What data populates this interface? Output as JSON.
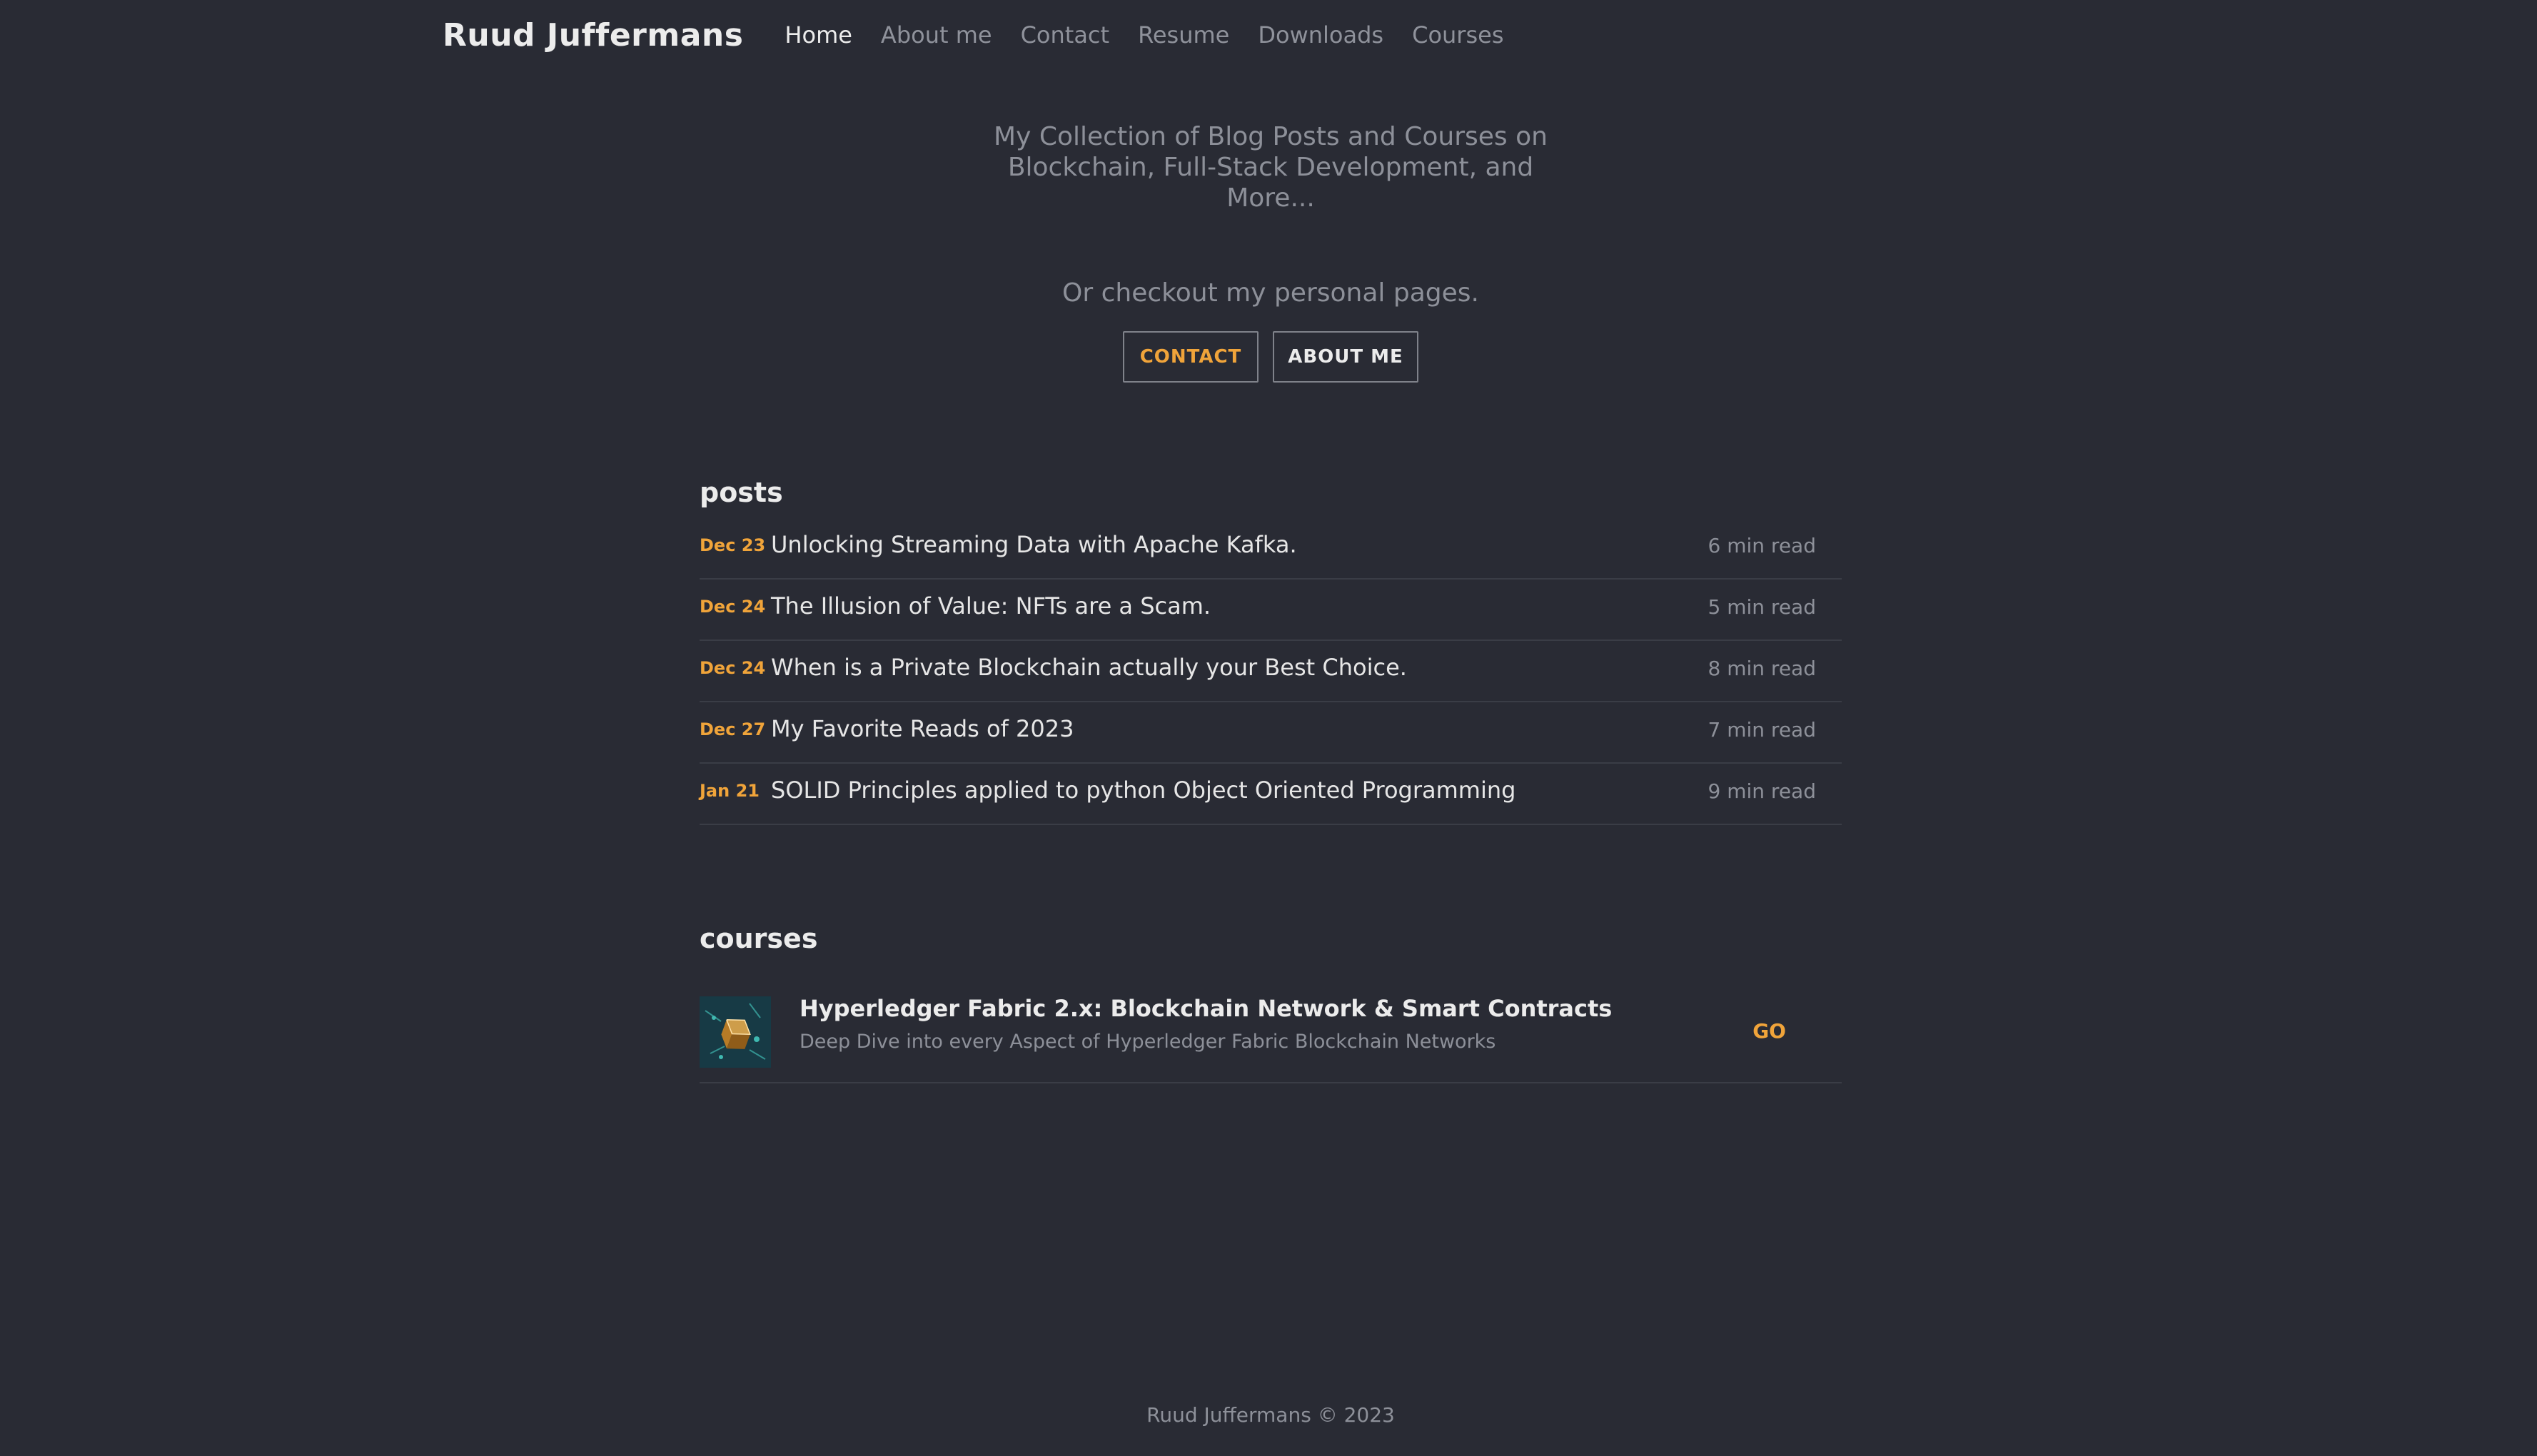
{
  "header": {
    "brand": "Ruud Juffermans",
    "nav": [
      {
        "label": "Home",
        "active": true
      },
      {
        "label": "About me",
        "active": false
      },
      {
        "label": "Contact",
        "active": false
      },
      {
        "label": "Resume",
        "active": false
      },
      {
        "label": "Downloads",
        "active": false
      },
      {
        "label": "Courses",
        "active": false
      }
    ]
  },
  "hero": {
    "tagline": "My Collection of Blog Posts and Courses on Blockchain, Full-Stack Development, and More...",
    "personal_text": "Or checkout my personal pages.",
    "contact_button": "CONTACT",
    "about_button": "ABOUT ME"
  },
  "posts": {
    "title": "posts",
    "items": [
      {
        "date": "Dec 23",
        "title": "Unlocking Streaming Data with Apache Kafka.",
        "read": "6 min read"
      },
      {
        "date": "Dec 24",
        "title": "The Illusion of Value: NFTs are a Scam.",
        "read": "5 min read"
      },
      {
        "date": "Dec 24",
        "title": "When is a Private Blockchain actually your Best Choice.",
        "read": "8 min read"
      },
      {
        "date": "Dec 27",
        "title": "My Favorite Reads of 2023",
        "read": "7 min read"
      },
      {
        "date": "Jan 21",
        "title": "SOLID Principles applied to python Object Oriented Programming",
        "read": "9 min read"
      }
    ]
  },
  "courses": {
    "title": "courses",
    "items": [
      {
        "title": "Hyperledger Fabric 2.x: Blockchain Network & Smart Contracts",
        "description": "Deep Dive into every Aspect of Hyperledger Fabric Blockchain Networks",
        "go": "GO",
        "thumbnail_icon": "blockchain-cube-icon"
      }
    ]
  },
  "footer": {
    "text": "Ruud Juffermans © 2023"
  },
  "colors": {
    "background": "#292b34",
    "accent": "#f0a43a",
    "muted": "#8d9099",
    "text": "#ececec"
  }
}
